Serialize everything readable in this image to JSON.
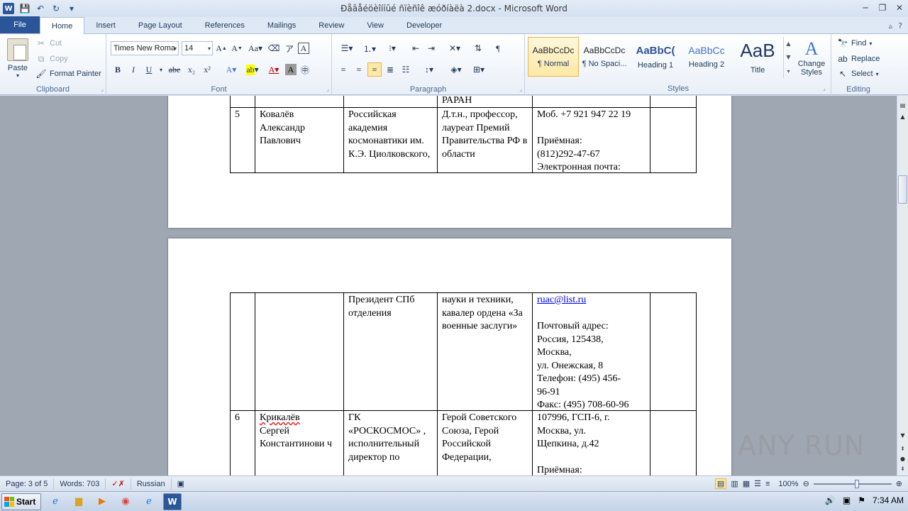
{
  "window": {
    "title": "Ðåâåéöèîííûé ñïèñîê æóðíàëà 2.docx - Microsoft Word",
    "controls": [
      "─",
      "❐",
      "✕"
    ]
  },
  "ribbon_tabs": [
    "File",
    "Home",
    "Insert",
    "Page Layout",
    "References",
    "Mailings",
    "Review",
    "View",
    "Developer"
  ],
  "active_tab": "Home",
  "clipboard": {
    "label": "Clipboard",
    "paste": "Paste",
    "cut": "Cut",
    "copy": "Copy",
    "format_painter": "Format Painter"
  },
  "font": {
    "label": "Font",
    "family": "Times New Roma",
    "size": "14"
  },
  "paragraph": {
    "label": "Paragraph"
  },
  "styles": {
    "label": "Styles",
    "items": [
      {
        "sample": "AaBbCcDc",
        "name": "¶ Normal"
      },
      {
        "sample": "AaBbCcDc",
        "name": "¶ No Spaci..."
      },
      {
        "sample": "AaBbC(",
        "name": "Heading 1"
      },
      {
        "sample": "AaBbCc",
        "name": "Heading 2"
      },
      {
        "sample": "AaB",
        "name": "Title"
      }
    ],
    "change_styles": "Change Styles"
  },
  "editing": {
    "label": "Editing",
    "find": "Find",
    "replace": "Replace",
    "select": "Select"
  },
  "document": {
    "page1": {
      "prev_row_fragment": "РАРАН",
      "row": {
        "num": "5",
        "name": "Ковалёв Александр Павлович",
        "org": "Российская академия космонавтики им. К.Э. Циолковского,",
        "title": "Д.т.н., профессор, лауреат Премий Правительства РФ в области",
        "contacts": [
          "Моб. +7 921 947 22 19",
          "",
          "Приёмная:",
          "(812)292-47-67",
          "Электронная почта:"
        ]
      }
    },
    "page2": {
      "cont_row": {
        "org": "Президент СПб отделения",
        "title": "науки и техники, кавалер ордена «За военные заслуги»",
        "email": "ruac@list.ru",
        "contacts": [
          "",
          "Почтовый адрес:",
          "Россия, 125438,",
          "Москва,",
          "ул. Онежская, 8",
          "Телефон: (495) 456-",
          "96-91",
          "Факс: (495) 708-60-96"
        ]
      },
      "row6": {
        "num": "6",
        "surname": "Крикалёв",
        "name_rest": "Сергей Константинови ч",
        "org": "ГК «РОСКОСМОС» , исполнительный директор по",
        "title": "Герой Советского Союза, Герой Российской Федерации,",
        "contacts": [
          "107996, ГСП-6, г.",
          "Москва, ул.",
          "Щепкина, д.42",
          "",
          "Приёмная:"
        ]
      }
    }
  },
  "statusbar": {
    "page": "Page: 3 of 5",
    "words": "Words: 703",
    "language": "Russian",
    "zoom": "100%",
    "zoom_level_percent": 100
  },
  "taskbar": {
    "start": "Start",
    "time": "7:34 AM"
  },
  "watermark": "ANY RUN"
}
